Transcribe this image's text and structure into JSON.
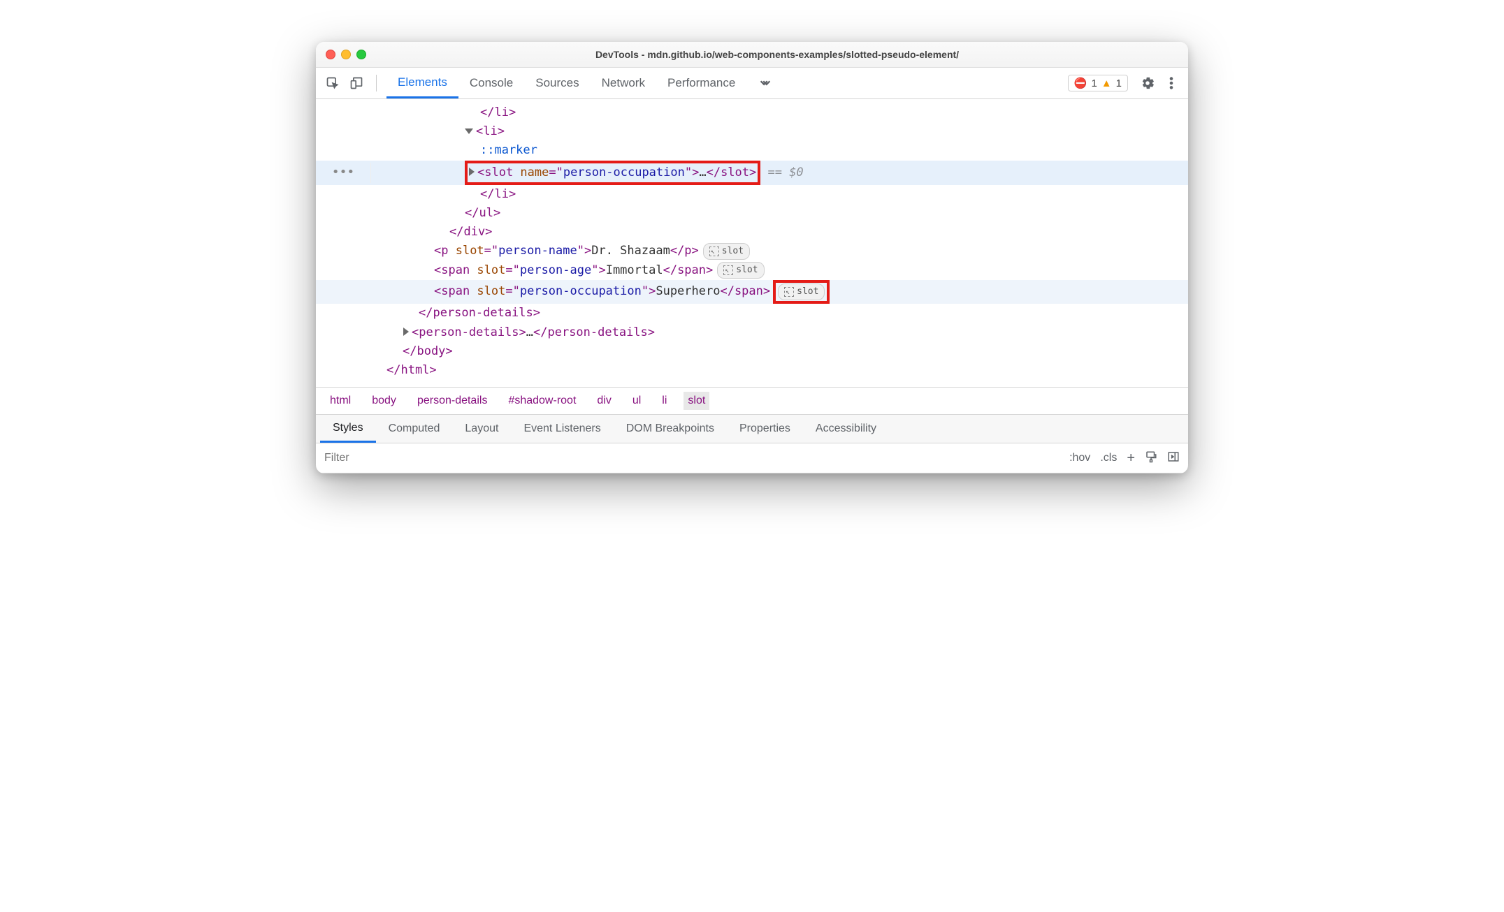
{
  "window_title": "DevTools - mdn.github.io/web-components-examples/slotted-pseudo-element/",
  "tabs": {
    "elements": "Elements",
    "console": "Console",
    "sources": "Sources",
    "network": "Network",
    "performance": "Performance"
  },
  "issues": {
    "errors": "1",
    "warnings": "1"
  },
  "sub_tabs": {
    "styles": "Styles",
    "computed": "Computed",
    "layout": "Layout",
    "event_listeners": "Event Listeners",
    "dom_breakpoints": "DOM Breakpoints",
    "properties": "Properties",
    "accessibility": "Accessibility"
  },
  "filter_placeholder": "Filter",
  "styles_tools": {
    "hov": ":hov",
    "cls": ".cls",
    "plus": "+"
  },
  "breadcrumb": [
    "html",
    "body",
    "person-details",
    "#shadow-root",
    "div",
    "ul",
    "li",
    "slot"
  ],
  "slot_badge_text": "slot",
  "dom": {
    "li_close": "</li>",
    "li_open": "<li>",
    "marker": "::marker",
    "slot_open1": "<slot ",
    "slot_attr_name": "name",
    "slot_eq": "=\"",
    "slot_attr_val": "person-occupation",
    "slot_open2": "\">",
    "ellipsis": "…",
    "slot_close": "</slot>",
    "after_eq": " == $0",
    "li_close2": "</li>",
    "ul_close": "</ul>",
    "div_close": "</div>",
    "p_open": "<p ",
    "slot_attr": "slot",
    "p_val": "person-name",
    "p_close_open": "\">",
    "p_text": "Dr. Shazaam",
    "p_close": "</p>",
    "span1_val": "person-age",
    "span1_text": "Immortal",
    "span2_val": "person-occupation",
    "span2_text": "Superhero",
    "span_open": "<span ",
    "span_close": "</span>",
    "pd_close": "</person-details>",
    "pd_open": "<person-details>",
    "body_close": "</body>",
    "html_close": "</html>",
    "gutter_dots": "•••"
  }
}
